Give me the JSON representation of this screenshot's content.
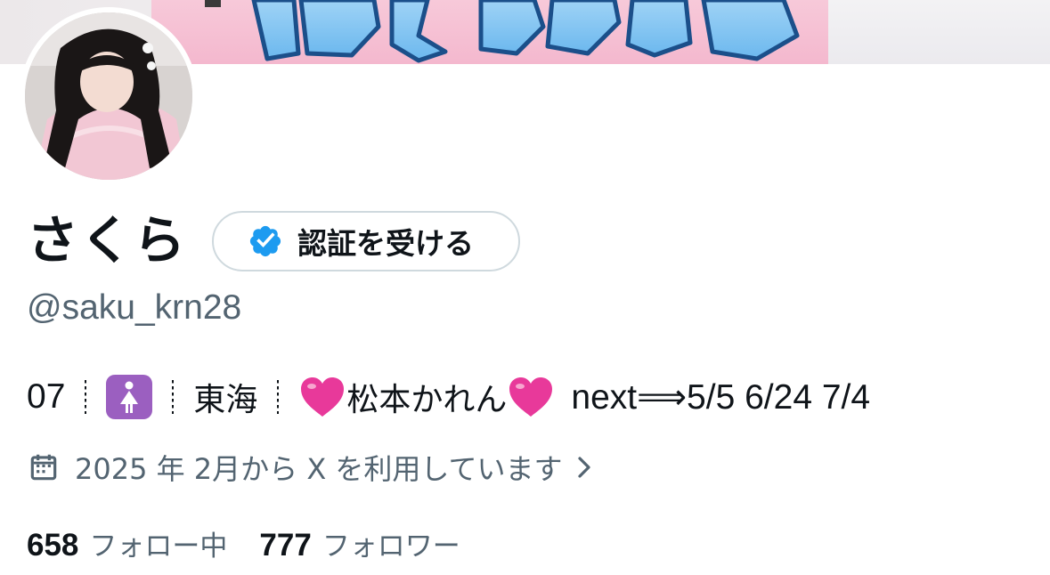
{
  "banner": {
    "headline_text": "帰りたいよう"
  },
  "profile": {
    "display_name": "さくら",
    "handle": "@saku_krn28",
    "verify_button_label": "認証を受ける",
    "avatar_icon": "profile-photo"
  },
  "bio": {
    "part1": "07",
    "emoji1": "womens-restroom-emoji",
    "part2": "東海",
    "emoji2": "pink-heart-emoji",
    "part3": "松本かれん",
    "emoji3": "pink-heart-emoji",
    "part4": "next⟹5/5 6/24 7/4"
  },
  "joined": {
    "icon": "calendar-icon",
    "text": "2025 年 2月から X を利用しています",
    "chevron": "chevron-right-icon"
  },
  "counts": {
    "following_count": "658",
    "following_label": "フォロー中",
    "followers_count": "777",
    "followers_label": "フォロワー"
  },
  "colors": {
    "primary_text": "#0f1419",
    "secondary_text": "#536471",
    "verified_blue": "#1d9bf0",
    "border": "#cfd9de",
    "heart_pink": "#e8399a"
  }
}
